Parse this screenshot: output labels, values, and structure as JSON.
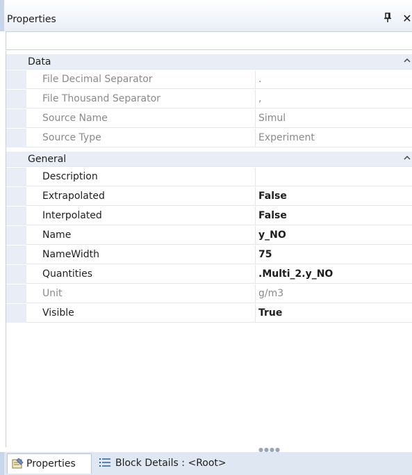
{
  "window": {
    "title": "Properties"
  },
  "categories": [
    {
      "label": "Data",
      "rows": [
        {
          "name": "File Decimal Separator",
          "value": "."
        },
        {
          "name": "File Thousand Separator",
          "value": ","
        },
        {
          "name": "Source Name",
          "value": "Simul"
        },
        {
          "name": "Source Type",
          "value": "Experiment"
        }
      ]
    },
    {
      "label": "General",
      "rows": [
        {
          "name": "Description",
          "value": ""
        },
        {
          "name": "Extrapolated",
          "value": "False"
        },
        {
          "name": "Interpolated",
          "value": "False"
        },
        {
          "name": "Name",
          "value": "y_NO"
        },
        {
          "name": "NameWidth",
          "value": "75"
        },
        {
          "name": "Quantities",
          "value": ".Multi_2.y_NO"
        },
        {
          "name": "Unit",
          "value": "g/m3"
        },
        {
          "name": "Visible",
          "value": "True"
        }
      ]
    }
  ],
  "tabs": [
    {
      "label": "Properties",
      "icon": "properties-icon"
    },
    {
      "label": "Block Details : <Root>",
      "icon": "list-icon"
    }
  ],
  "colors": {
    "category_bg": "#e9eef6",
    "dim_text": "#8a8a8a",
    "border": "#c5cfdd"
  }
}
